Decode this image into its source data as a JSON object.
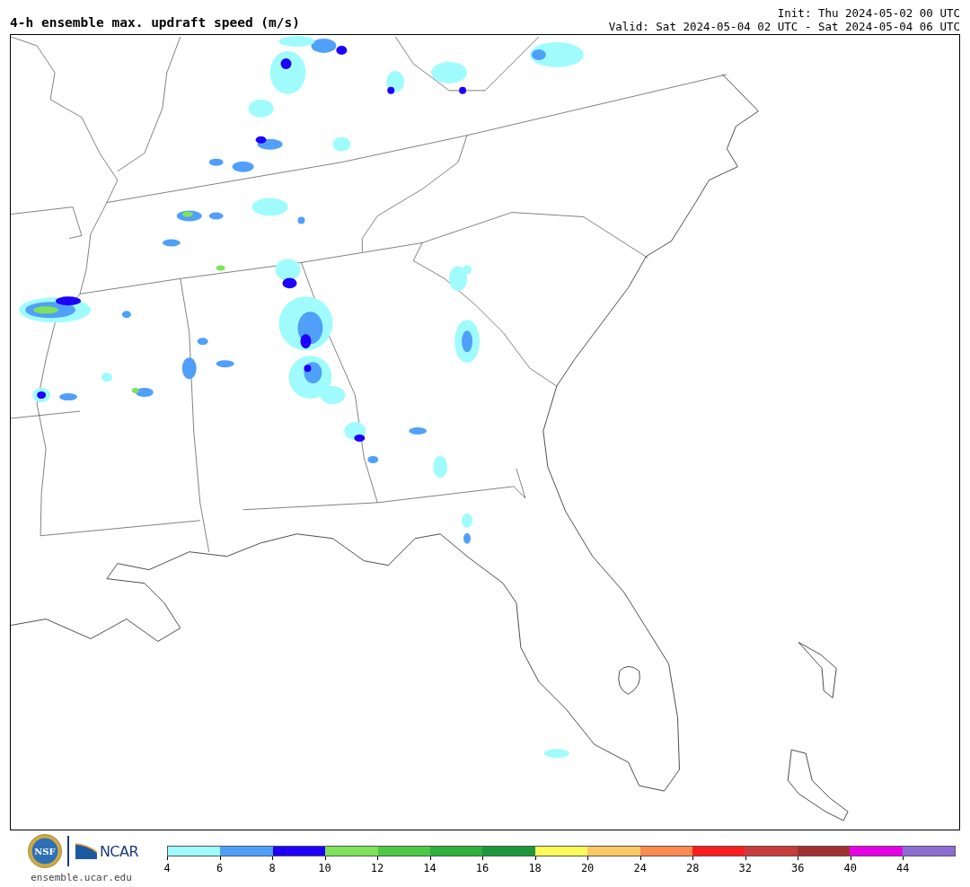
{
  "header": {
    "title": "4-h ensemble max. updraft speed (m/s)",
    "init": "Init: Thu 2024-05-02 00 UTC",
    "valid": "Valid: Sat 2024-05-04 02 UTC - Sat 2024-05-04 06 UTC"
  },
  "footer": {
    "nsf_logo": "NSF",
    "ncar_logo": "NCAR",
    "url": "ensemble.ucar.edu"
  },
  "colorbar": {
    "segments": [
      {
        "color": "#a0fcfc"
      },
      {
        "color": "#50a0fa"
      },
      {
        "color": "#1e00fa"
      },
      {
        "color": "#7ee35a"
      },
      {
        "color": "#4ec946"
      },
      {
        "color": "#2eb03c"
      },
      {
        "color": "#1e963c"
      },
      {
        "color": "#fafa5a"
      },
      {
        "color": "#fcc864"
      },
      {
        "color": "#fc8a50"
      },
      {
        "color": "#fa1e1e"
      },
      {
        "color": "#c83c3c"
      },
      {
        "color": "#a03232"
      },
      {
        "color": "#e600e6"
      },
      {
        "color": "#8c6ed2"
      }
    ],
    "tick_labels": [
      "4",
      "6",
      "8",
      "10",
      "12",
      "14",
      "16",
      "18",
      "20",
      "24",
      "28",
      "32",
      "36",
      "40",
      "44"
    ]
  }
}
